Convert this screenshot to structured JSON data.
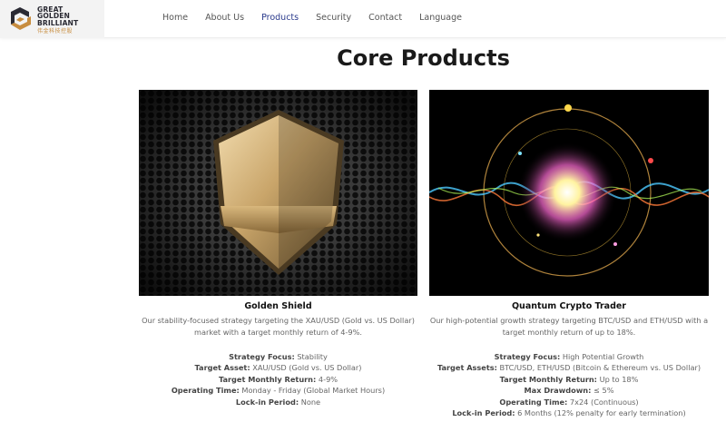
{
  "brand": {
    "name_lines": [
      "GREAT",
      "GOLDEN",
      "BRILLIANT"
    ],
    "name_cn": "伟金科技控股",
    "colors": {
      "navy": "#2a2a33",
      "gold": "#c88d3f"
    }
  },
  "nav": {
    "items": [
      {
        "label": "Home",
        "active": false
      },
      {
        "label": "About Us",
        "active": false
      },
      {
        "label": "Products",
        "active": true
      },
      {
        "label": "Security",
        "active": false
      },
      {
        "label": "Contact",
        "active": false
      },
      {
        "label": "Language",
        "active": false
      }
    ],
    "active_color": "#2a3a8c"
  },
  "page": {
    "title": "Core Products"
  },
  "products": [
    {
      "image_icon": "golden-shield-image",
      "title": "Golden Shield",
      "description": "Our stability-focused strategy targeting the XAU/USD (Gold vs. US Dollar) market with a target monthly return of 4-9%.",
      "specs": [
        {
          "label": "Strategy Focus:",
          "value": "Stability"
        },
        {
          "label": "Target Asset:",
          "value": "XAU/USD (Gold vs. US Dollar)"
        },
        {
          "label": "Target Monthly Return:",
          "value": "4-9%"
        },
        {
          "label": "Operating Time:",
          "value": "Monday - Friday (Global Market Hours)"
        },
        {
          "label": "Lock-in Period:",
          "value": "None"
        }
      ]
    },
    {
      "image_icon": "quantum-crypto-image",
      "title": "Quantum Crypto Trader",
      "description": "Our high-potential growth strategy targeting BTC/USD and ETH/USD with a target monthly return of up to 18%.",
      "specs": [
        {
          "label": "Strategy Focus:",
          "value": "High Potential Growth"
        },
        {
          "label": "Target Assets:",
          "value": "BTC/USD, ETH/USD (Bitcoin & Ethereum vs. US Dollar)"
        },
        {
          "label": "Target Monthly Return:",
          "value": "Up to 18%"
        },
        {
          "label": "Max Drawdown:",
          "value": "≤ 5%"
        },
        {
          "label": "Operating Time:",
          "value": "7x24 (Continuous)"
        },
        {
          "label": "Lock-in Period:",
          "value": "6 Months (12% penalty for early termination)"
        }
      ]
    }
  ]
}
